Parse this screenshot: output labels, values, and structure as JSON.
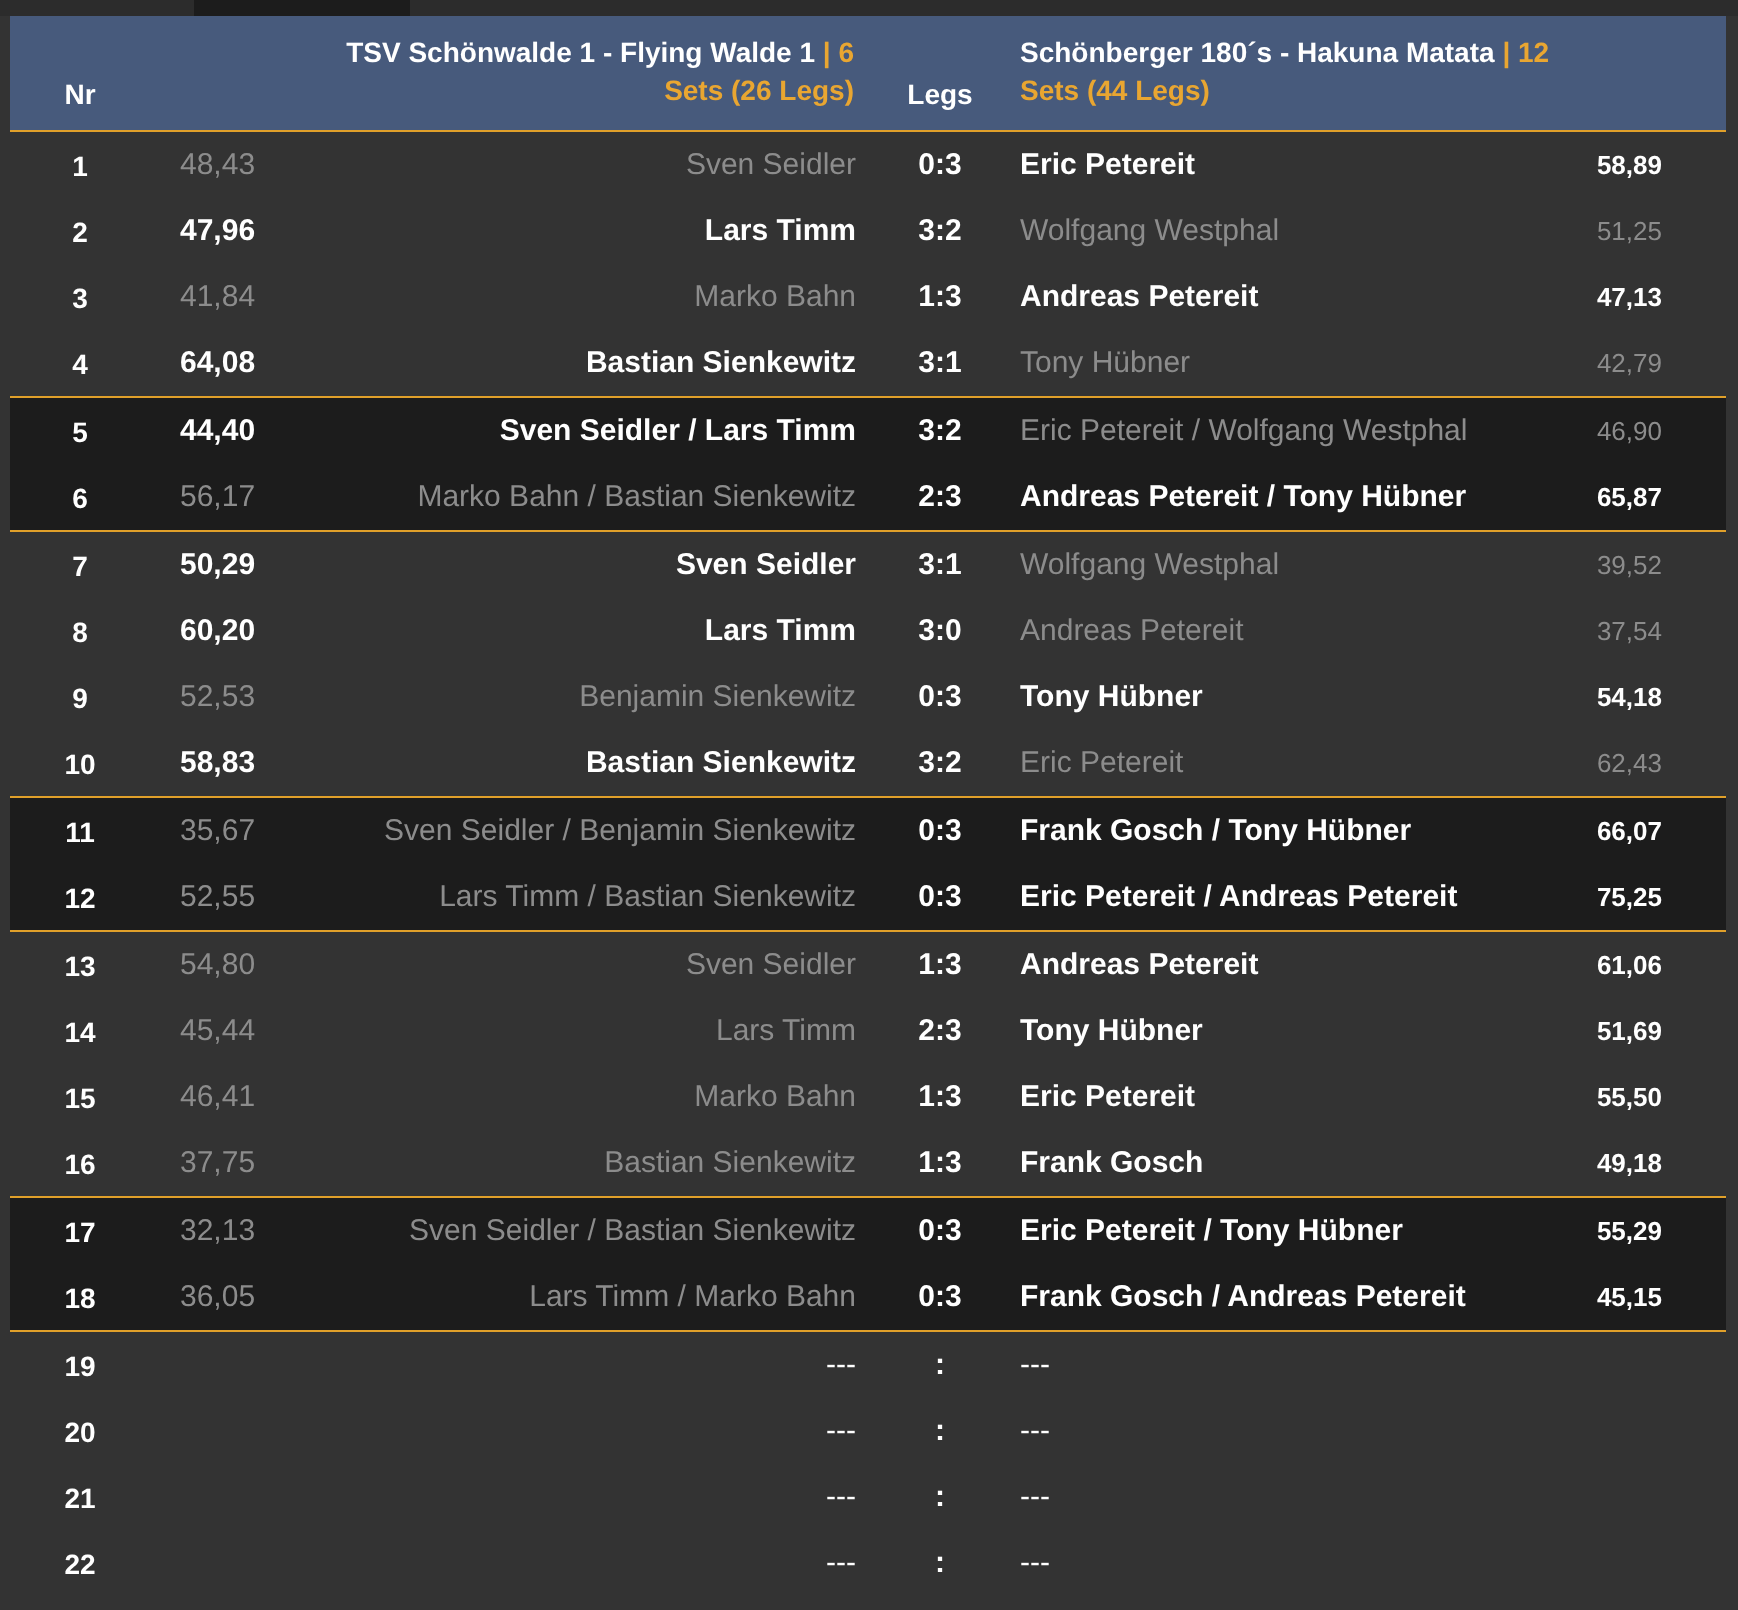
{
  "header": {
    "nr": "Nr",
    "home_team": "TSV Schönwalde 1 - Flying Walde 1",
    "home_score": "| 6 Sets (26 Legs)",
    "legs": "Legs",
    "away_team": "Schönberger 180´s - Hakuna Matata",
    "away_score": "| 12 Sets (44 Legs)"
  },
  "groups": [
    {
      "kind": "singles",
      "rows": [
        {
          "nr": "1",
          "home_avg": "48,43",
          "home": "Sven Seidler",
          "legs": "0:3",
          "away": "Eric Petereit",
          "away_avg": "58,89",
          "home_won": false,
          "away_won": true
        },
        {
          "nr": "2",
          "home_avg": "47,96",
          "home": "Lars Timm",
          "legs": "3:2",
          "away": "Wolfgang Westphal",
          "away_avg": "51,25",
          "home_won": true,
          "away_won": false
        },
        {
          "nr": "3",
          "home_avg": "41,84",
          "home": "Marko Bahn",
          "legs": "1:3",
          "away": "Andreas Petereit",
          "away_avg": "47,13",
          "home_won": false,
          "away_won": true
        },
        {
          "nr": "4",
          "home_avg": "64,08",
          "home": "Bastian Sienkewitz",
          "legs": "3:1",
          "away": "Tony Hübner",
          "away_avg": "42,79",
          "home_won": true,
          "away_won": false
        }
      ]
    },
    {
      "kind": "doubles",
      "rows": [
        {
          "nr": "5",
          "home_avg": "44,40",
          "home": "Sven Seidler / Lars Timm",
          "legs": "3:2",
          "away": "Eric Petereit / Wolfgang Westphal",
          "away_avg": "46,90",
          "home_won": true,
          "away_won": false
        },
        {
          "nr": "6",
          "home_avg": "56,17",
          "home": "Marko Bahn / Bastian Sienkewitz",
          "legs": "2:3",
          "away": "Andreas Petereit / Tony Hübner",
          "away_avg": "65,87",
          "home_won": false,
          "away_won": true
        }
      ]
    },
    {
      "kind": "singles",
      "rows": [
        {
          "nr": "7",
          "home_avg": "50,29",
          "home": "Sven Seidler",
          "legs": "3:1",
          "away": "Wolfgang Westphal",
          "away_avg": "39,52",
          "home_won": true,
          "away_won": false
        },
        {
          "nr": "8",
          "home_avg": "60,20",
          "home": "Lars Timm",
          "legs": "3:0",
          "away": "Andreas Petereit",
          "away_avg": "37,54",
          "home_won": true,
          "away_won": false
        },
        {
          "nr": "9",
          "home_avg": "52,53",
          "home": "Benjamin Sienkewitz",
          "legs": "0:3",
          "away": "Tony Hübner",
          "away_avg": "54,18",
          "home_won": false,
          "away_won": true
        },
        {
          "nr": "10",
          "home_avg": "58,83",
          "home": "Bastian Sienkewitz",
          "legs": "3:2",
          "away": "Eric Petereit",
          "away_avg": "62,43",
          "home_won": true,
          "away_won": false
        }
      ]
    },
    {
      "kind": "doubles",
      "rows": [
        {
          "nr": "11",
          "home_avg": "35,67",
          "home": "Sven Seidler / Benjamin Sienkewitz",
          "legs": "0:3",
          "away": "Frank Gosch / Tony Hübner",
          "away_avg": "66,07",
          "home_won": false,
          "away_won": true
        },
        {
          "nr": "12",
          "home_avg": "52,55",
          "home": "Lars Timm / Bastian Sienkewitz",
          "legs": "0:3",
          "away": "Eric Petereit / Andreas Petereit",
          "away_avg": "75,25",
          "home_won": false,
          "away_won": true
        }
      ]
    },
    {
      "kind": "singles",
      "rows": [
        {
          "nr": "13",
          "home_avg": "54,80",
          "home": "Sven Seidler",
          "legs": "1:3",
          "away": "Andreas Petereit",
          "away_avg": "61,06",
          "home_won": false,
          "away_won": true
        },
        {
          "nr": "14",
          "home_avg": "45,44",
          "home": "Lars Timm",
          "legs": "2:3",
          "away": "Tony Hübner",
          "away_avg": "51,69",
          "home_won": false,
          "away_won": true
        },
        {
          "nr": "15",
          "home_avg": "46,41",
          "home": "Marko Bahn",
          "legs": "1:3",
          "away": "Eric Petereit",
          "away_avg": "55,50",
          "home_won": false,
          "away_won": true
        },
        {
          "nr": "16",
          "home_avg": "37,75",
          "home": "Bastian Sienkewitz",
          "legs": "1:3",
          "away": "Frank Gosch",
          "away_avg": "49,18",
          "home_won": false,
          "away_won": true
        }
      ]
    },
    {
      "kind": "doubles",
      "rows": [
        {
          "nr": "17",
          "home_avg": "32,13",
          "home": "Sven Seidler / Bastian Sienkewitz",
          "legs": "0:3",
          "away": "Eric Petereit / Tony Hübner",
          "away_avg": "55,29",
          "home_won": false,
          "away_won": true
        },
        {
          "nr": "18",
          "home_avg": "36,05",
          "home": "Lars Timm / Marko Bahn",
          "legs": "0:3",
          "away": "Frank Gosch / Andreas Petereit",
          "away_avg": "45,15",
          "home_won": false,
          "away_won": true
        }
      ]
    },
    {
      "kind": "open",
      "rows": [
        {
          "nr": "19",
          "home": "---",
          "legs": ":",
          "away": "---"
        },
        {
          "nr": "20",
          "home": "---",
          "legs": ":",
          "away": "---"
        },
        {
          "nr": "21",
          "home": "---",
          "legs": ":",
          "away": "---"
        },
        {
          "nr": "22",
          "home": "---",
          "legs": ":",
          "away": "---"
        }
      ]
    }
  ]
}
